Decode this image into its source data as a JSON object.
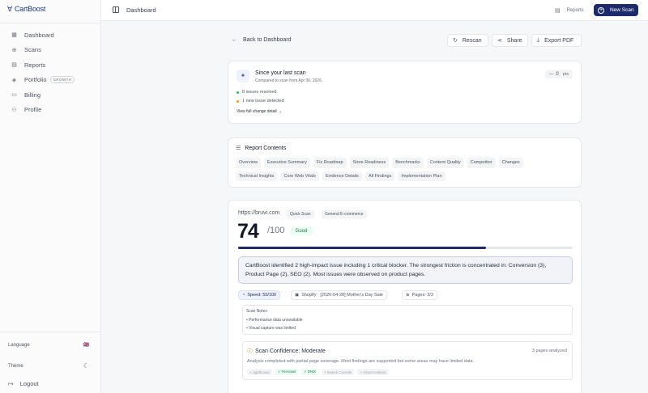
{
  "brand": {
    "name": "CartBoost",
    "tagline": "—"
  },
  "sidebar": {
    "items": [
      {
        "icon": "grid-icon",
        "glyph": "▦",
        "label": "Dashboard"
      },
      {
        "icon": "plus-circle-icon",
        "glyph": "⊕",
        "label": "Scans"
      },
      {
        "icon": "document-icon",
        "glyph": "▤",
        "label": "Reports"
      },
      {
        "icon": "layers-icon",
        "glyph": "◈",
        "label": "Portfolio",
        "badge": "GROWTH"
      },
      {
        "icon": "card-icon",
        "glyph": "▭",
        "label": "Billing"
      },
      {
        "icon": "user-icon",
        "glyph": "⚇",
        "label": "Profile"
      }
    ],
    "language_label": "Language",
    "language_flag": "🇬🇧",
    "theme_label": "Theme",
    "theme_glyph": "☾",
    "logout_label": "Logout"
  },
  "topbar": {
    "breadcrumb": "Dashboard",
    "reports_label": "Reports",
    "new_scan_label": "New Scan"
  },
  "actions": {
    "back_label": "Back to Dashboard",
    "rescan_label": "Rescan",
    "share_label": "Share",
    "export_label": "Export PDF"
  },
  "since": {
    "title": "Since your last scan",
    "subtitle": "Compared to scan from Apr 30, 2026",
    "points_value": "0",
    "points_unit": "pts",
    "resolved": "8 issues resolved",
    "new_issue": "1 new issue detected",
    "link": "View full change detail →",
    "colors": {
      "resolved": "#22c55e",
      "new": "#f59e0b"
    }
  },
  "contents": {
    "title": "Report Contents",
    "row1": [
      "Overview",
      "Executive Summary",
      "Fix Roadmap",
      "Store Readiness",
      "Benchmarks",
      "Content Quality",
      "Competitor",
      "Changes"
    ],
    "row2": [
      "Technical Insights",
      "Core Web Vitals",
      "Evidence Details",
      "All Findings",
      "Implementation Plan"
    ]
  },
  "scan": {
    "url": "https://bruvi.com",
    "tag_quick": "Quick Scan",
    "tag_category": "General E-commerce",
    "score": "74",
    "score_max": "/100",
    "rating": "Good",
    "score_fraction": 0.74,
    "summary": "CartBoost identified 2 high-impact issue including 1 critical blocker. The strongest friction is concentrated in: Conversion (3), Product Page (2), SEO (2). Most issues were observed on product pages.",
    "speed": "Speed: 55/100",
    "platform": "Shopify · [2026-04-28] Mother's Day Sale",
    "pages": "Pages: 3/3",
    "notes_title": "Scan Notes",
    "notes": [
      "• Performance data unavailable",
      "• Visual capture was limited"
    ],
    "confidence_title": "Scan Confidence: Moderate",
    "confidence_pages": "3 pages analyzed",
    "confidence_desc": "Analysis completed with partial page coverage. Most findings are supported but some areas may have limited data.",
    "sources": [
      {
        "label": "× Lighthouse",
        "ok": false
      },
      {
        "label": "✓ Firecrawl",
        "ok": true
      },
      {
        "label": "✓ DNIX",
        "ok": true
      },
      {
        "label": "× Search Console",
        "ok": false
      },
      {
        "label": "× Visual Analysis",
        "ok": false
      }
    ]
  }
}
